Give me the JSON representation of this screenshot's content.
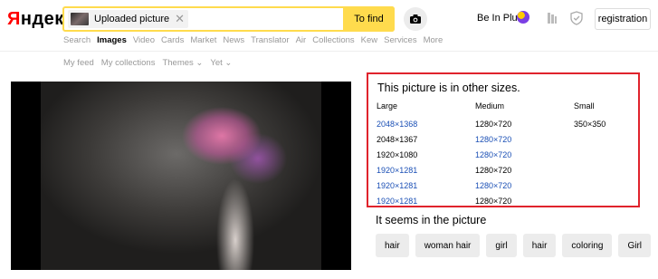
{
  "logo": "Яндекс",
  "search": {
    "tag_label": "Uploaded picture",
    "find_label": "To find"
  },
  "header": {
    "plus_label": "Be In Plus",
    "registration_label": "registration"
  },
  "services": [
    "Search",
    "Images",
    "Video",
    "Cards",
    "Market",
    "News",
    "Translator",
    "Air",
    "Collections",
    "Kew",
    "Services",
    "More"
  ],
  "services_active": "Images",
  "subnav": [
    "My feed",
    "My collections",
    "Themes ⌄",
    "Yet ⌄"
  ],
  "info": {
    "title": "This picture is in other sizes.",
    "columns": [
      {
        "header": "Large",
        "items": [
          {
            "text": "2048×1368",
            "link": true
          },
          {
            "text": "2048×1367",
            "link": false
          },
          {
            "text": "1920×1080",
            "link": false
          },
          {
            "text": "1920×1281",
            "link": true
          },
          {
            "text": "1920×1281",
            "link": true
          },
          {
            "text": "1920×1281",
            "link": true
          }
        ]
      },
      {
        "header": "Medium",
        "items": [
          {
            "text": "1280×720",
            "link": false
          },
          {
            "text": "1280×720",
            "link": true
          },
          {
            "text": "1280×720",
            "link": true
          },
          {
            "text": "1280×720",
            "link": false
          },
          {
            "text": "1280×720",
            "link": true
          },
          {
            "text": "1280×720",
            "link": false
          }
        ]
      },
      {
        "header": "Small",
        "items": [
          {
            "text": "350×350",
            "link": false
          }
        ]
      }
    ]
  },
  "seems": {
    "title": "It seems in the picture",
    "tags": [
      "hair",
      "woman hair",
      "girl",
      "hair",
      "coloring",
      "Girl"
    ]
  },
  "colors": {
    "accent": "#ffdb4d",
    "highlight_border": "#e0232c",
    "link": "#1a4fb5",
    "logo_red": "#ff0000"
  }
}
